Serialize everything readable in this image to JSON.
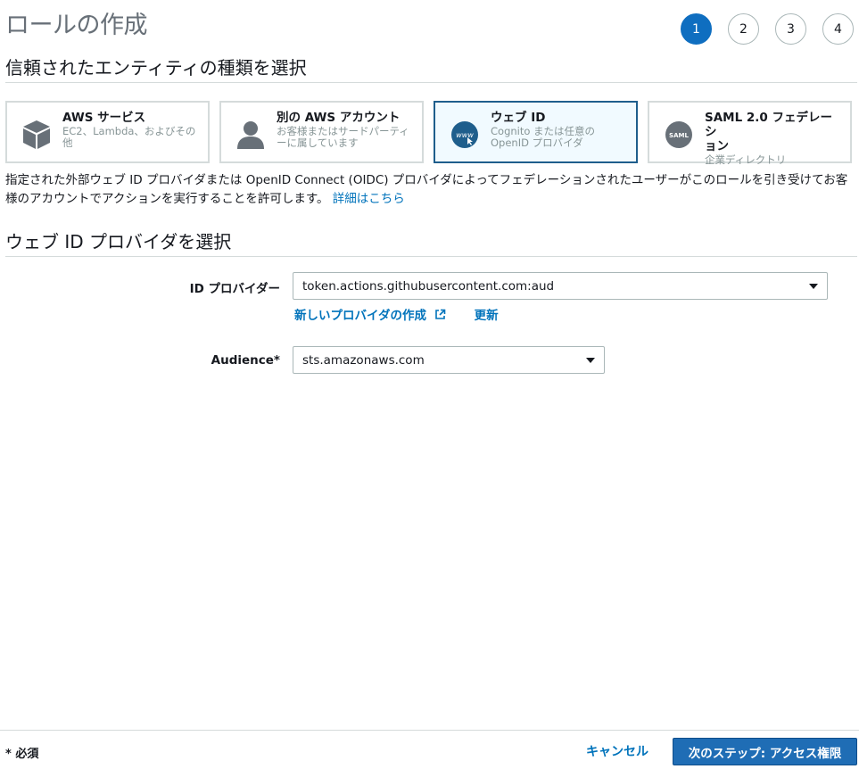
{
  "header": {
    "title": "ロールの作成",
    "steps": [
      "1",
      "2",
      "3",
      "4"
    ]
  },
  "trusted_entity": {
    "heading": "信頼されたエンティティの種類を選択",
    "cards": [
      {
        "title": "AWS サービス",
        "desc_1": "EC2、Lambda、およびその",
        "desc_2": "他",
        "icon": "cube-icon"
      },
      {
        "title": "別の AWS アカウント",
        "desc_1": "お客様またはサードパーティ",
        "desc_2": "ーに属しています",
        "icon": "person-icon"
      },
      {
        "title": "ウェブ ID",
        "desc_1": "Cognito または任意の",
        "desc_2": "OpenID プロバイダ",
        "icon": "www-icon"
      },
      {
        "title_1": "SAML 2.0 フェデレーシ",
        "title_2": "ョン",
        "desc_1": "企業ディレクトリ",
        "icon": "saml-icon",
        "icon_text": "SAML"
      }
    ],
    "intro_text": "指定された外部ウェブ ID プロバイダまたは OpenID Connect (OIDC) プロバイダによってフェデレーションされたユーザーがこのロールを引き受けてお客様のアカウントでアクションを実行することを許可します。",
    "learn_more": "詳細はこちら"
  },
  "provider_section": {
    "heading": "ウェブ ID プロバイダを選択",
    "id_provider_label": "ID プロバイダー",
    "id_provider_value": "token.actions.githubusercontent.com:aud",
    "create_provider_link": "新しいプロバイダの作成",
    "refresh_link": "更新",
    "audience_label": "Audience*",
    "audience_value": "sts.amazonaws.com"
  },
  "footer": {
    "required_note": "* 必須",
    "cancel_label": "キャンセル",
    "next_label": "次のステップ: アクセス権限"
  },
  "colors": {
    "accent": "#0f6ec0",
    "link": "#0073bb",
    "selected_border": "#1f5e8c"
  }
}
